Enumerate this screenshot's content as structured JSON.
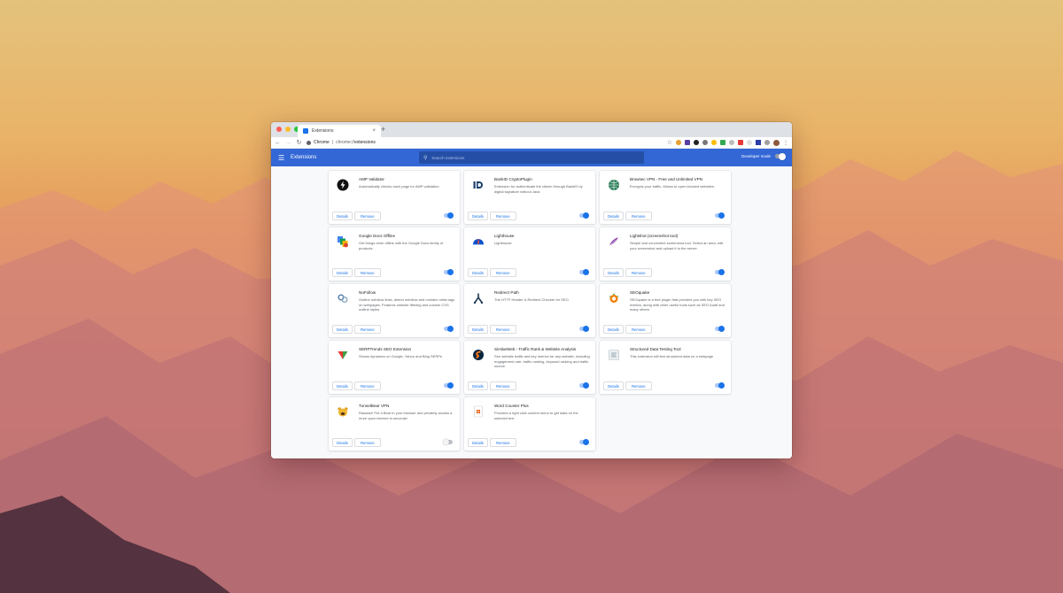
{
  "window": {
    "tab_title": "Extensions",
    "tab_close": "×",
    "new_tab": "+",
    "omnibox_host": "Chrome",
    "omnibox_sep": "|",
    "omnibox_scheme": "chrome://",
    "omnibox_path": "extensions"
  },
  "header": {
    "title": "Extensions",
    "search_placeholder": "Search extensions",
    "developer_mode_label": "Developer mode",
    "developer_mode_on": false
  },
  "buttons": {
    "details": "Details",
    "remove": "Remove"
  },
  "extensions": [
    {
      "name": "AMP Validator",
      "description": "Automatically checks each page for AMP validation.",
      "icon": "lightning-bolt-icon",
      "enabled": true
    },
    {
      "name": "BankID CryptoPlugin",
      "description": "Extension for authenticate the citizen through BankID by digital signature without Java",
      "icon": "bankid-icon",
      "enabled": true
    },
    {
      "name": "Browsec VPN - Free and Unlimited VPN",
      "description": "Encrypts your traffic. Allows to open blocked websites.",
      "icon": "globe-icon",
      "enabled": true
    },
    {
      "name": "Google Docs Offline",
      "description": "Get things done offline with the Google Docs family of products.",
      "icon": "google-docs-icon",
      "enabled": true
    },
    {
      "name": "Lighthouse",
      "description": "Lighthouse",
      "icon": "lighthouse-icon",
      "enabled": true
    },
    {
      "name": "Lightshot (screenshot tool)",
      "description": "Simple and convenient screenshot tool. Select an area, edit your screenshot and upload it to the server.",
      "icon": "feather-icon",
      "enabled": true
    },
    {
      "name": "NoFollow",
      "description": "Outline nofollow links, detect nofollow and noindex meta tags on webpages. Features website filtering and custom CSS outline styles.",
      "icon": "link-icon",
      "enabled": true
    },
    {
      "name": "Redirect Path",
      "description": "The HTTP Header & Redirect Checker for SEO",
      "icon": "redirect-icon",
      "enabled": true
    },
    {
      "name": "SEOquake",
      "description": "SEOquake is a free plugin that provides you with key SEO metrics, along with other useful tools such as SEO Audit and many others",
      "icon": "seoquake-icon",
      "enabled": true
    },
    {
      "name": "SERPTrends SEO Extension",
      "description": "Shows dynamics on Google, Yahoo and Bing SERPs",
      "icon": "serptrends-icon",
      "enabled": true
    },
    {
      "name": "SimilarWeb - Traffic Rank & Website Analysis",
      "description": "See website traffic and key metrics for any website, including engagement rate, traffic ranking, keyword ranking and traffic source.",
      "icon": "similarweb-icon",
      "enabled": true
    },
    {
      "name": "Structured Data Testing Tool",
      "description": "This extension will test structured data on a webpage",
      "icon": "structured-data-icon",
      "enabled": true
    },
    {
      "name": "TunnelBear VPN",
      "description": "Rawwwr! Put a Bear in your browser and privately access a more open internet in seconds!",
      "icon": "bear-icon",
      "enabled": false
    },
    {
      "name": "Word Counter Plus",
      "description": "Provides a right click context menu to get stats on the selected text",
      "icon": "word-counter-icon",
      "enabled": true
    }
  ],
  "colors": {
    "appbar": "#3367d6",
    "accent": "#1a73e8"
  }
}
